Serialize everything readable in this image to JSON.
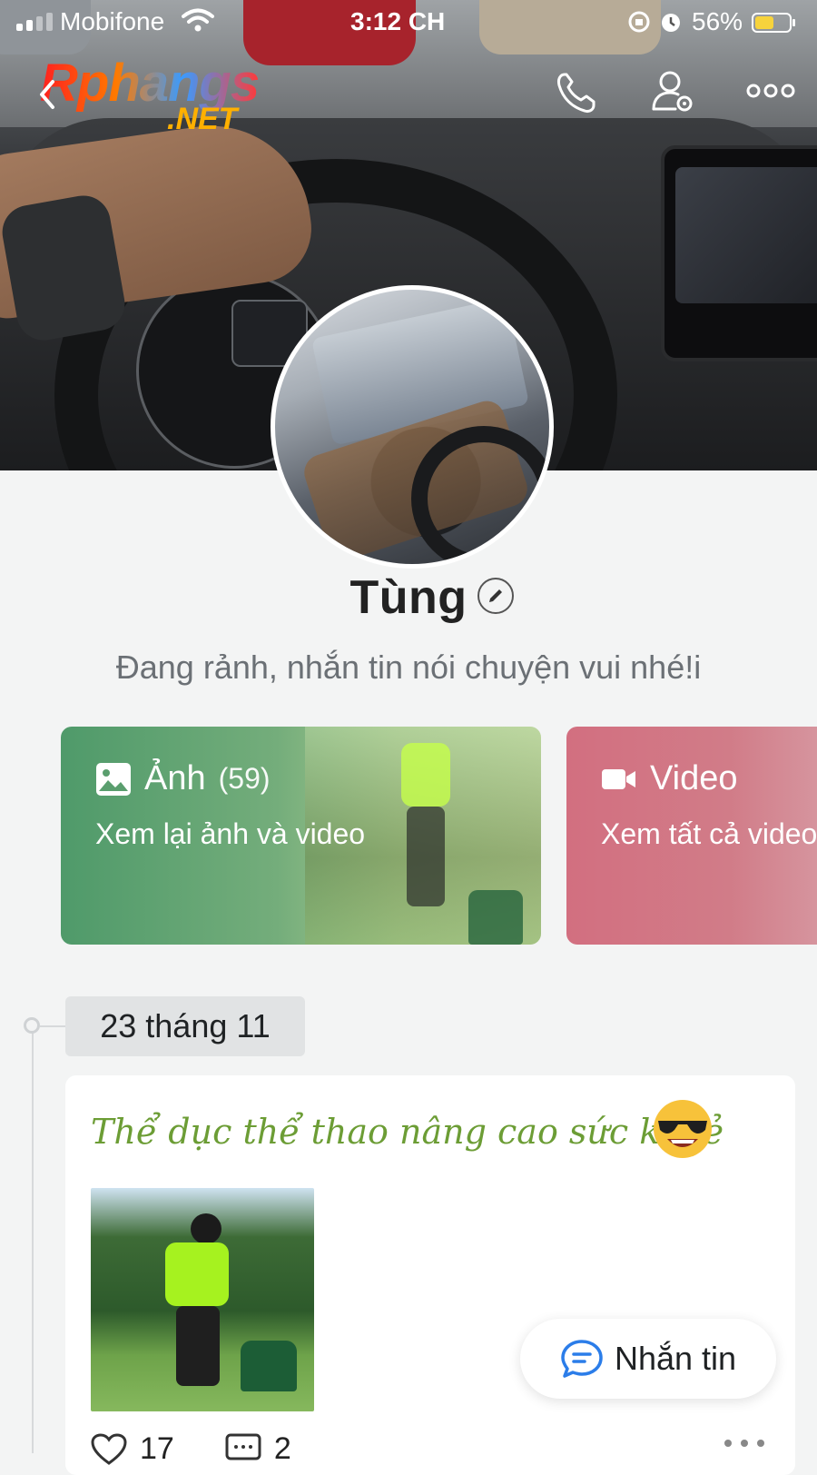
{
  "status_bar": {
    "carrier": "Mobifone",
    "time": "3:12 CH",
    "battery_percent": "56%",
    "battery_level": 0.56,
    "battery_color": "#f7d33c"
  },
  "watermark": {
    "brand": "Rphangs",
    "domain": ".NET"
  },
  "header": {
    "icons": [
      "phone-icon",
      "user-settings-icon",
      "more-icon"
    ]
  },
  "profile": {
    "name": "Tùng",
    "status": "Đang rảnh, nhắn tin nói chuyện vui nhé!i"
  },
  "media_cards": [
    {
      "title": "Ảnh",
      "count": "(59)",
      "subtitle": "Xem lại ảnh và video",
      "icon": "image-icon",
      "color": "#4f9a6a"
    },
    {
      "title": "Video",
      "count": "",
      "subtitle": "Xem tất cả video",
      "icon": "video-icon",
      "color": "#d26f80"
    }
  ],
  "timeline": {
    "date": "23 tháng 11",
    "post": {
      "title": "Thể dục thể thao nâng cao sức khoẻ",
      "emoji": "sunglasses-emoji",
      "likes": "17",
      "comments": "2"
    }
  },
  "fab": {
    "label": "Nhắn tin",
    "accent": "#2b7de9"
  }
}
